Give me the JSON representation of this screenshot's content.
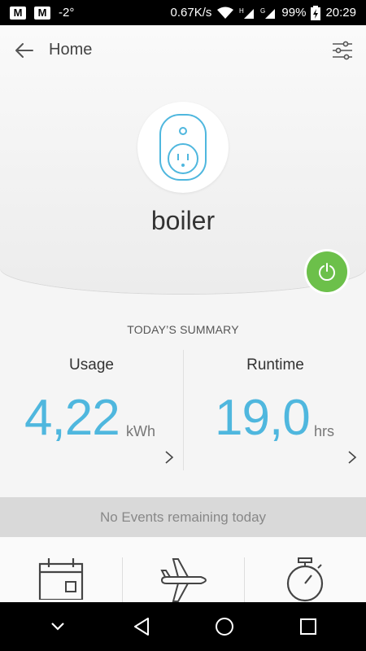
{
  "status_bar": {
    "temperature": "-2°",
    "net_speed": "0.67K/s",
    "net_h": "H",
    "net_g": "G",
    "battery": "99%",
    "time": "20:29",
    "icons": [
      "mail-icon",
      "mail-icon",
      "wifi-icon",
      "signal-icon",
      "signal-icon",
      "battery-charging-icon"
    ]
  },
  "header": {
    "title": "Home",
    "back_icon": "arrow-left-icon",
    "settings_icon": "sliders-icon"
  },
  "device": {
    "name": "boiler",
    "icon": "smart-plug-icon",
    "power_state": "on",
    "power_color": "#6cc04a"
  },
  "summary": {
    "title": "TODAY’S SUMMARY",
    "usage": {
      "label": "Usage",
      "value": "4,22",
      "unit": "kWh"
    },
    "runtime": {
      "label": "Runtime",
      "value": "19,0",
      "unit": "hrs"
    },
    "value_color": "#4fb7de"
  },
  "events": {
    "text": "No Events remaining today"
  },
  "actions": [
    {
      "icon": "calendar-icon"
    },
    {
      "icon": "airplane-icon"
    },
    {
      "icon": "stopwatch-icon"
    }
  ],
  "nav": {
    "icons": [
      "chevron-down-icon",
      "back-triangle-icon",
      "home-circle-icon",
      "recents-square-icon"
    ]
  }
}
